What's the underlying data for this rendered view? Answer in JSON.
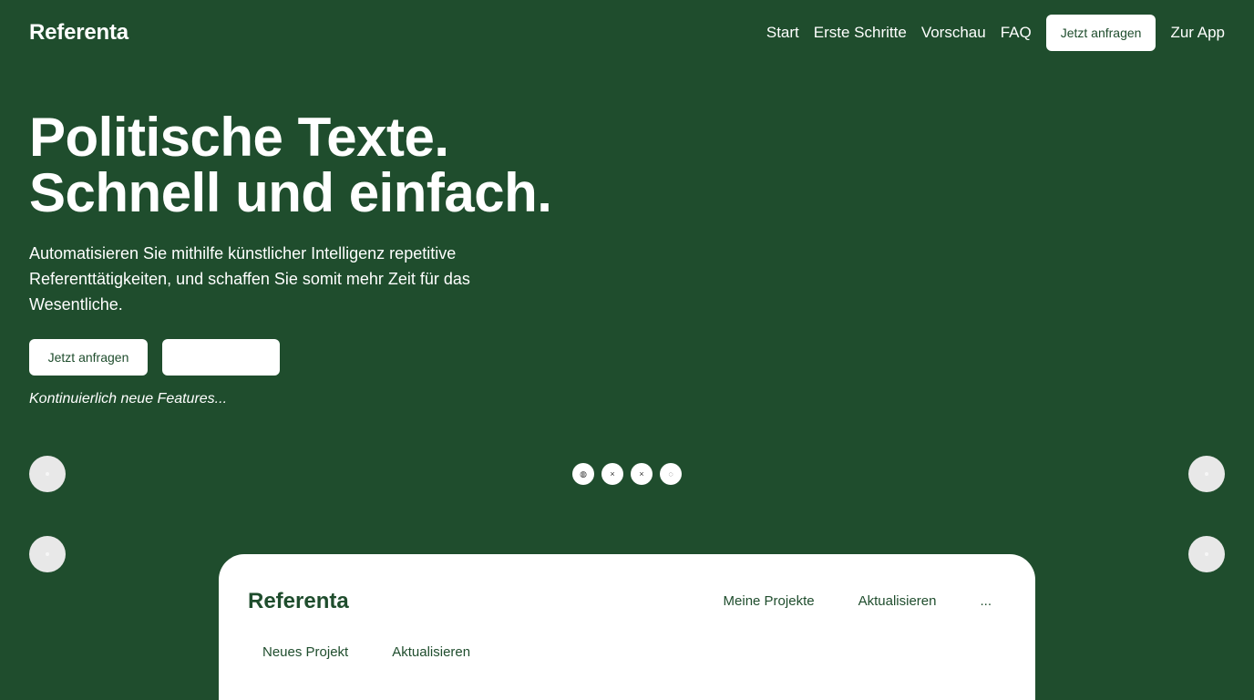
{
  "header": {
    "brand": "Referenta",
    "nav": [
      "Start",
      "Erste Schritte",
      "Vorschau",
      "FAQ"
    ],
    "cta": "Jetzt anfragen",
    "app_link": "Zur App"
  },
  "hero": {
    "title_line1": "Politische Texte.",
    "title_line2": "Schnell und einfach.",
    "subtitle": "Automatisieren Sie mithilfe künstlicher Intelligenz repetitive Referenttätigkeiten, und schaffen Sie somit mehr Zeit für das Wesentliche.",
    "primary_button": "Jetzt anfragen",
    "secondary_button": "",
    "features_note": "Kontinuierlich neue Features..."
  },
  "carousel": {
    "dots": [
      "◍",
      "×",
      "×",
      "◌"
    ]
  },
  "preview_card": {
    "brand": "Referenta",
    "nav": [
      "Meine Projekte",
      "Aktualisieren",
      "..."
    ],
    "actions": [
      "Neues Projekt",
      "Aktualisieren"
    ]
  },
  "colors": {
    "background": "#1f4d2d",
    "text_light": "#ffffff",
    "button_bg": "#ffffff"
  }
}
